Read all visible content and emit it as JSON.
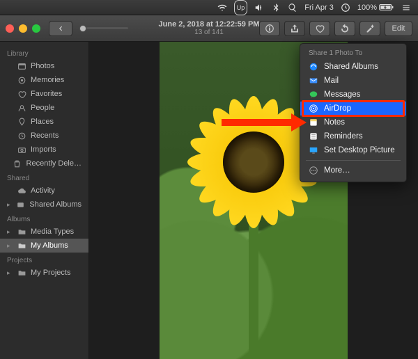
{
  "menubar": {
    "wifi_icon": "wifi",
    "up_icon": "up-logo",
    "sound_icon": "sound",
    "bt_icon": "bluetooth",
    "search_icon": "search",
    "datetime": "Fri Apr 3",
    "clock_icon": "clock",
    "battery_pct": "100%",
    "battery_icon": "battery-charging",
    "menu_icon": "menu"
  },
  "titlebar": {
    "back_icon": "chevron-left",
    "title_line1": "June 2, 2018 at 12:22:59 PM",
    "title_line2": "13 of 141",
    "buttons": {
      "info_icon": "info",
      "share_icon": "share",
      "favorite_icon": "heart",
      "rotate_icon": "rotate",
      "enhance_icon": "magic-wand",
      "edit_label": "Edit"
    }
  },
  "sidebar": {
    "sections": [
      {
        "header": "Library",
        "items": [
          {
            "icon": "photos",
            "label": "Photos"
          },
          {
            "icon": "memories",
            "label": "Memories"
          },
          {
            "icon": "favorites",
            "label": "Favorites"
          },
          {
            "icon": "people",
            "label": "People"
          },
          {
            "icon": "places",
            "label": "Places"
          },
          {
            "icon": "recents",
            "label": "Recents"
          },
          {
            "icon": "imports",
            "label": "Imports"
          },
          {
            "icon": "trash",
            "label": "Recently Dele…"
          }
        ]
      },
      {
        "header": "Shared",
        "items": [
          {
            "icon": "cloud",
            "label": "Activity"
          },
          {
            "icon": "shared-albums",
            "label": "Shared Albums",
            "expandable": true
          }
        ]
      },
      {
        "header": "Albums",
        "items": [
          {
            "icon": "folder",
            "label": "Media Types",
            "expandable": true
          },
          {
            "icon": "folder",
            "label": "My Albums",
            "expandable": true,
            "selected": true
          }
        ]
      },
      {
        "header": "Projects",
        "items": [
          {
            "icon": "folder",
            "label": "My Projects",
            "expandable": true
          }
        ]
      }
    ]
  },
  "share_popover": {
    "header": "Share 1 Photo To",
    "options": [
      {
        "icon": "shared-albums",
        "label": "Shared Albums",
        "color": "#1e88ff"
      },
      {
        "icon": "mail",
        "label": "Mail",
        "color": "#3a8fff"
      },
      {
        "icon": "messages",
        "label": "Messages",
        "color": "#34c759"
      },
      {
        "icon": "airdrop",
        "label": "AirDrop",
        "color": "#2aa6ff",
        "highlighted": true,
        "boxed": true
      },
      {
        "icon": "notes",
        "label": "Notes",
        "color": "#f5d76e"
      },
      {
        "icon": "reminders",
        "label": "Reminders",
        "color": "#eee"
      },
      {
        "icon": "desktop",
        "label": "Set Desktop Picture",
        "color": "#2aa6ff"
      }
    ],
    "more_label": "More…",
    "more_icon": "ellipsis"
  }
}
